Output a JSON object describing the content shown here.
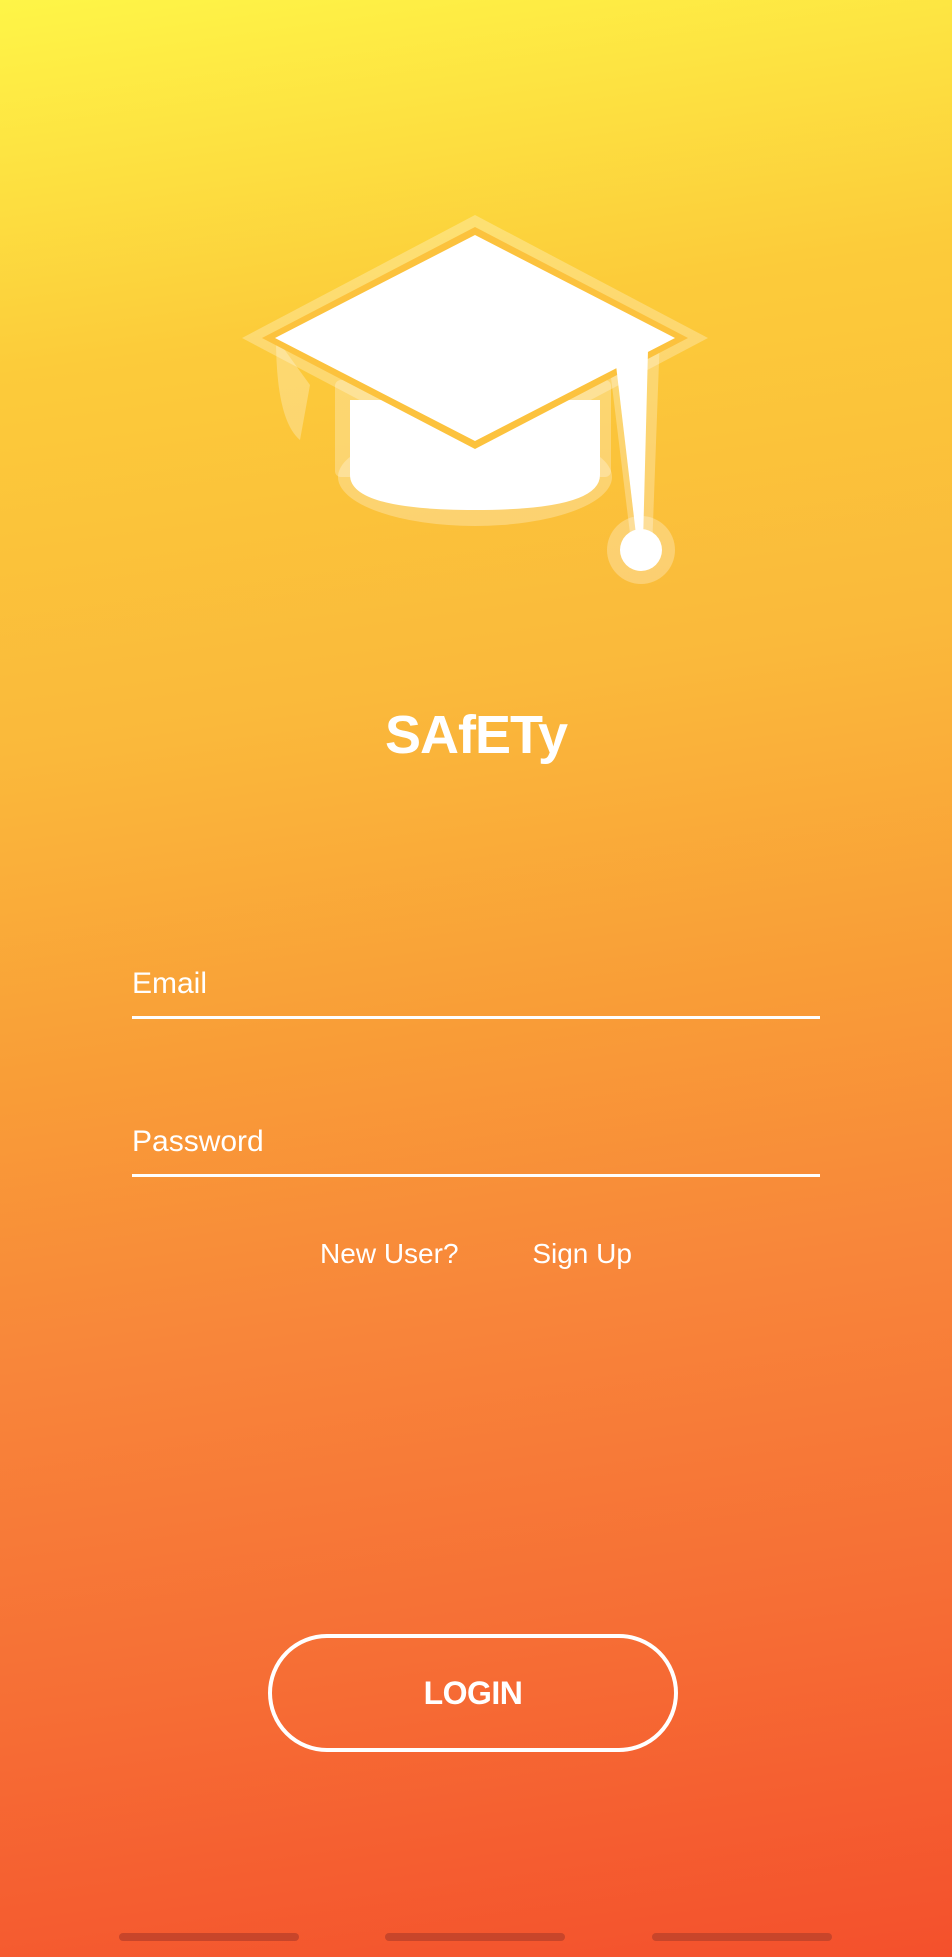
{
  "app": {
    "name": "SAfETy",
    "logo_icon": "graduation-cap-icon"
  },
  "form": {
    "email_placeholder": "Email",
    "email_value": "",
    "password_placeholder": "Password",
    "password_value": ""
  },
  "signup": {
    "prompt": "New User?",
    "link_label": "Sign Up"
  },
  "login": {
    "label": "LOGIN"
  },
  "colors": {
    "gradient_top": "#FEF547",
    "gradient_bottom": "#F4502C",
    "text": "#FFFFFF"
  }
}
